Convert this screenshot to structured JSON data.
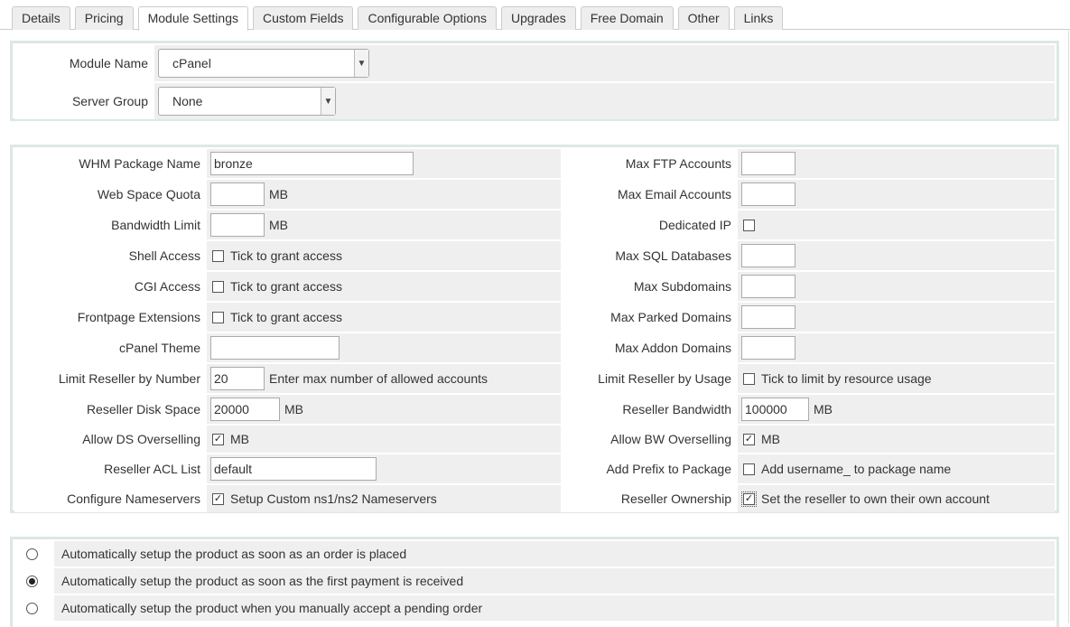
{
  "tabs": [
    {
      "label": "Details",
      "active": false
    },
    {
      "label": "Pricing",
      "active": false
    },
    {
      "label": "Module Settings",
      "active": true
    },
    {
      "label": "Custom Fields",
      "active": false
    },
    {
      "label": "Configurable Options",
      "active": false
    },
    {
      "label": "Upgrades",
      "active": false
    },
    {
      "label": "Free Domain",
      "active": false
    },
    {
      "label": "Other",
      "active": false
    },
    {
      "label": "Links",
      "active": false
    }
  ],
  "module": {
    "module_name_label": "Module Name",
    "module_name_value": "cPanel",
    "server_group_label": "Server Group",
    "server_group_value": "None"
  },
  "settings": {
    "whm_package_label": "WHM Package Name",
    "whm_package_value": "bronze",
    "web_space_label": "Web Space Quota",
    "web_space_value": "",
    "mb": "MB",
    "bandwidth_label": "Bandwidth Limit",
    "bandwidth_value": "",
    "shell_label": "Shell Access",
    "tick_grant": "Tick to grant access",
    "cgi_label": "CGI Access",
    "frontpage_label": "Frontpage Extensions",
    "cpanel_theme_label": "cPanel Theme",
    "cpanel_theme_value": "",
    "limit_number_label": "Limit Reseller by Number",
    "limit_number_value": "20",
    "limit_number_hint": "Enter max number of allowed accounts",
    "reseller_disk_label": "Reseller Disk Space",
    "reseller_disk_value": "20000",
    "allow_ds_label": "Allow DS Overselling",
    "reseller_acl_label": "Reseller ACL List",
    "reseller_acl_value": "default",
    "configure_ns_label": "Configure Nameservers",
    "configure_ns_text": "Setup Custom ns1/ns2 Nameservers",
    "max_ftp_label": "Max FTP Accounts",
    "max_email_label": "Max Email Accounts",
    "dedicated_ip_label": "Dedicated IP",
    "max_sql_label": "Max SQL Databases",
    "max_subdomains_label": "Max Subdomains",
    "max_parked_label": "Max Parked Domains",
    "max_addon_label": "Max Addon Domains",
    "limit_usage_label": "Limit Reseller by Usage",
    "limit_usage_text": "Tick to limit by resource usage",
    "reseller_bw_label": "Reseller Bandwidth",
    "reseller_bw_value": "100000",
    "allow_bw_label": "Allow BW Overselling",
    "add_prefix_label": "Add Prefix to Package",
    "add_prefix_text": "Add username_ to package name",
    "reseller_own_label": "Reseller Ownership",
    "reseller_own_text": "Set the reseller to own their own account"
  },
  "checkboxes": {
    "shell": false,
    "cgi": false,
    "frontpage": false,
    "allow_ds": true,
    "configure_ns": true,
    "dedicated_ip": false,
    "limit_usage": false,
    "allow_bw": true,
    "add_prefix": false,
    "reseller_own": true
  },
  "setup_options": [
    {
      "label": "Automatically setup the product as soon as an order is placed",
      "selected": false
    },
    {
      "label": "Automatically setup the product as soon as the first payment is received",
      "selected": true
    },
    {
      "label": "Automatically setup the product when you manually accept a pending order",
      "selected": false
    }
  ]
}
